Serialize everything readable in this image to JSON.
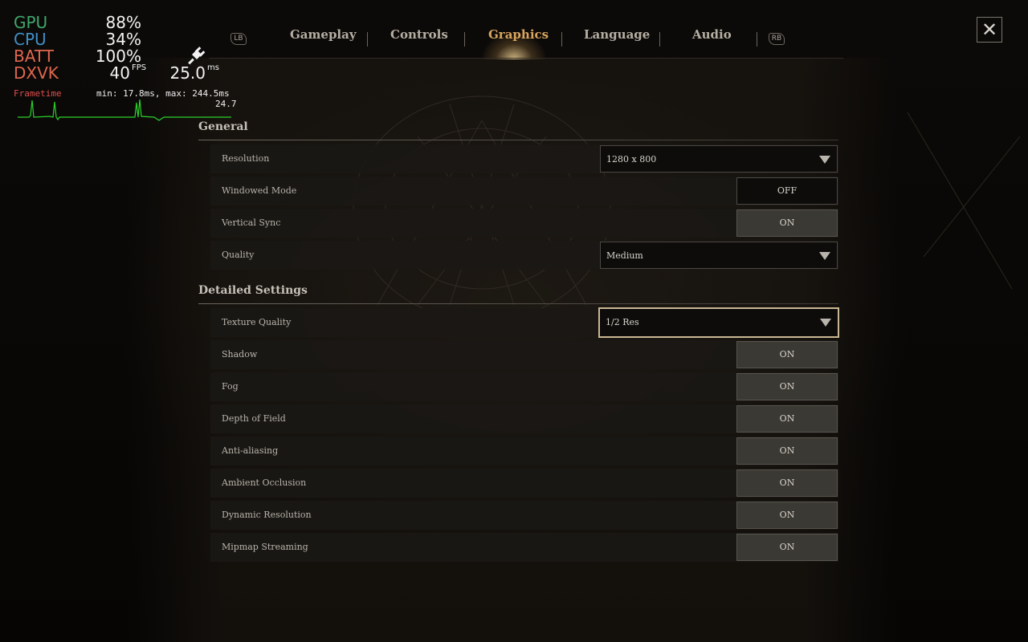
{
  "hud": {
    "gpu_label": "GPU",
    "gpu_value": "88%",
    "cpu_label": "CPU",
    "cpu_value": "34%",
    "batt_label": "BATT",
    "batt_value": "100%",
    "dxvk_label": "DXVK",
    "fps_value": "40",
    "fps_unit": "FPS",
    "ms_value": "25.0",
    "ms_unit": "ms",
    "frametime_label": "Frametime",
    "frametime_range": "min: 17.8ms, max: 244.5ms",
    "frametime_current": "24.7",
    "colors": {
      "gpu": "#3fa66b",
      "cpu": "#3f8fc9",
      "batt": "#e0664f",
      "dxvk": "#e0664f",
      "frametime": "#e05050",
      "graph": "#2bd12b"
    }
  },
  "tabs": {
    "lb": "LB",
    "rb": "RB",
    "items": [
      {
        "label": "Gameplay"
      },
      {
        "label": "Controls"
      },
      {
        "label": "Graphics",
        "active": true
      },
      {
        "label": "Language"
      },
      {
        "label": "Audio"
      }
    ]
  },
  "close_icon": "close-icon",
  "sections": {
    "general": {
      "title": "General",
      "rows": [
        {
          "label": "Resolution",
          "control": "dropdown",
          "value": "1280 x 800"
        },
        {
          "label": "Windowed Mode",
          "control": "toggle",
          "value": "OFF"
        },
        {
          "label": "Vertical Sync",
          "control": "toggle",
          "value": "ON"
        },
        {
          "label": "Quality",
          "control": "dropdown",
          "value": "Medium"
        }
      ]
    },
    "detailed": {
      "title": "Detailed Settings",
      "rows": [
        {
          "label": "Texture Quality",
          "control": "dropdown",
          "value": "1/2 Res",
          "focused": true
        },
        {
          "label": "Shadow",
          "control": "toggle",
          "value": "ON"
        },
        {
          "label": "Fog",
          "control": "toggle",
          "value": "ON"
        },
        {
          "label": "Depth of Field",
          "control": "toggle",
          "value": "ON"
        },
        {
          "label": "Anti-aliasing",
          "control": "toggle",
          "value": "ON"
        },
        {
          "label": "Ambient Occlusion",
          "control": "toggle",
          "value": "ON"
        },
        {
          "label": "Dynamic Resolution",
          "control": "toggle",
          "value": "ON"
        },
        {
          "label": "Mipmap Streaming",
          "control": "toggle",
          "value": "ON"
        }
      ]
    }
  }
}
